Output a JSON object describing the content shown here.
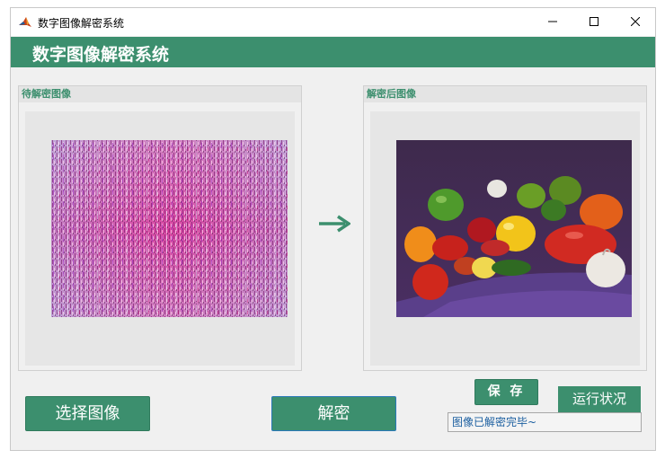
{
  "window": {
    "title": "数字图像解密系统"
  },
  "header": {
    "title": "数字图像解密系统"
  },
  "panels": {
    "encrypted": {
      "title": "待解密图像"
    },
    "decrypted": {
      "title": "解密后图像"
    }
  },
  "buttons": {
    "select_image": "选择图像",
    "decrypt": "解密",
    "save": "保 存"
  },
  "status": {
    "label": "运行状况",
    "message": "图像已解密完毕~"
  },
  "colors": {
    "accent": "#3c8f6e",
    "status_text": "#1c5fa0"
  },
  "icons": {
    "app": "matlab-icon",
    "arrow": "arrow-right-icon"
  }
}
